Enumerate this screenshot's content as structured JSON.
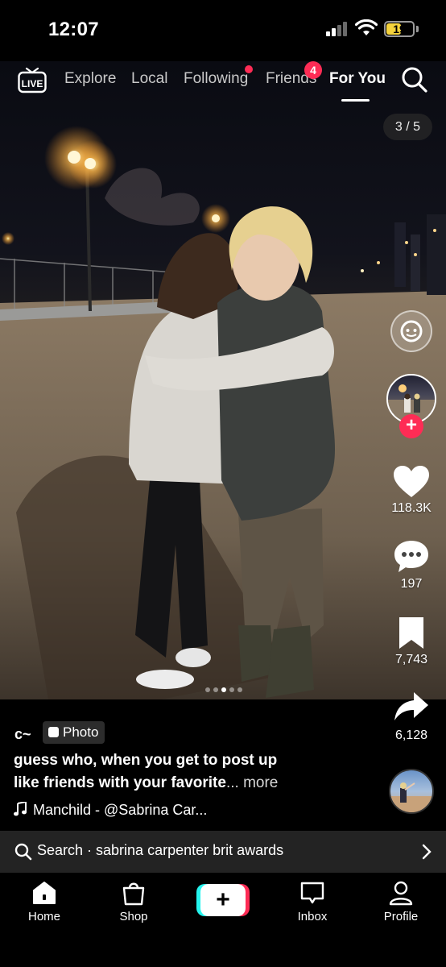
{
  "status_bar": {
    "time": "12:07",
    "battery": "19"
  },
  "top_nav": {
    "tabs": [
      {
        "label": "Explore"
      },
      {
        "label": "Local"
      },
      {
        "label": "Following"
      },
      {
        "label": "Friends"
      },
      {
        "label": "For You"
      }
    ],
    "active_tab": "For You",
    "friends_badge": "4",
    "live_label": "LIVE"
  },
  "post": {
    "photo_counter": "3 / 5",
    "carousel": {
      "total": 5,
      "current": 3
    },
    "author": "c~",
    "type_chip": "Photo",
    "caption_line1": "guess who, when you get to post up",
    "caption_line2": "like friends with your favorite",
    "caption_more": "... more",
    "music": "Manchild - @Sabrina Car...",
    "likes": "118.3K",
    "comments": "197",
    "saves": "7,743",
    "shares": "6,128"
  },
  "search_bar": {
    "text": "Search · sabrina carpenter brit awards"
  },
  "bottom_nav": {
    "home": "Home",
    "shop": "Shop",
    "inbox": "Inbox",
    "profile": "Profile"
  },
  "colors": {
    "accent": "#fe2c55",
    "cyan": "#25f4ee",
    "battery": "#f5d33d"
  }
}
